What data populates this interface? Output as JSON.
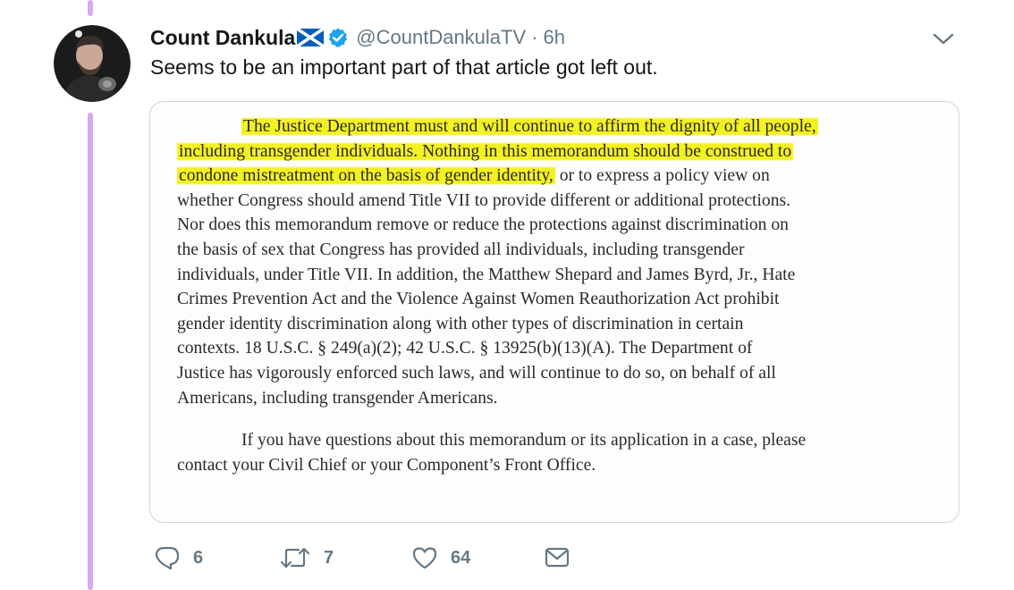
{
  "tweet": {
    "display_name": "Count Dankula",
    "flag_icon": "scotland-flag-icon",
    "verified_icon": "verified-badge-icon",
    "handle": "@CountDankulaTV",
    "separator": "·",
    "time_ago": "6h",
    "text": "Seems to be an important part of that article got left out.",
    "menu_icon": "chevron-down-icon"
  },
  "document": {
    "para1_lines": [
      {
        "highlighted": "The Justice Department must and will continue to affirm the dignity of all people,",
        "rest": ""
      },
      {
        "highlighted": "including transgender individuals.  Nothing in this memorandum should be construed to",
        "rest": ""
      },
      {
        "highlighted": "condone mistreatment on the basis of gender identity,",
        "rest": " or to express a policy view on"
      },
      {
        "highlighted": "",
        "rest": "whether Congress should amend Title VII to provide different or additional protections."
      },
      {
        "highlighted": "",
        "rest": "Nor does this memorandum remove or reduce the protections against discrimination on"
      },
      {
        "highlighted": "",
        "rest": "the basis of sex that Congress has provided all individuals, including transgender"
      },
      {
        "highlighted": "",
        "rest": "individuals, under Title VII.  In addition, the Matthew Shepard and James Byrd, Jr., Hate"
      },
      {
        "highlighted": "",
        "rest": "Crimes Prevention Act and the Violence Against Women Reauthorization Act prohibit"
      },
      {
        "highlighted": "",
        "rest": "gender identity discrimination along with other types of discrimination in certain"
      },
      {
        "highlighted": "",
        "rest": "contexts.  18 U.S.C. § 249(a)(2); 42 U.S.C. § 13925(b)(13)(A).  The Department of"
      },
      {
        "highlighted": "",
        "rest": "Justice has vigorously enforced such laws, and will continue to do so, on behalf of all"
      },
      {
        "highlighted": "",
        "rest": "Americans, including transgender Americans."
      }
    ],
    "para2_lines": [
      "If you have questions about this memorandum or its application in a case, please",
      "contact your Civil Chief or your Component’s Front Office."
    ],
    "highlight_color": "#f4f122"
  },
  "actions": {
    "reply": {
      "icon": "reply-icon",
      "count": "6"
    },
    "retweet": {
      "icon": "retweet-icon",
      "count": "7"
    },
    "like": {
      "icon": "heart-icon",
      "count": "64"
    },
    "dm": {
      "icon": "envelope-icon"
    }
  },
  "colors": {
    "thread_line": "#d6a9f0",
    "verified": "#1da1f2",
    "secondary_text": "#657786"
  }
}
